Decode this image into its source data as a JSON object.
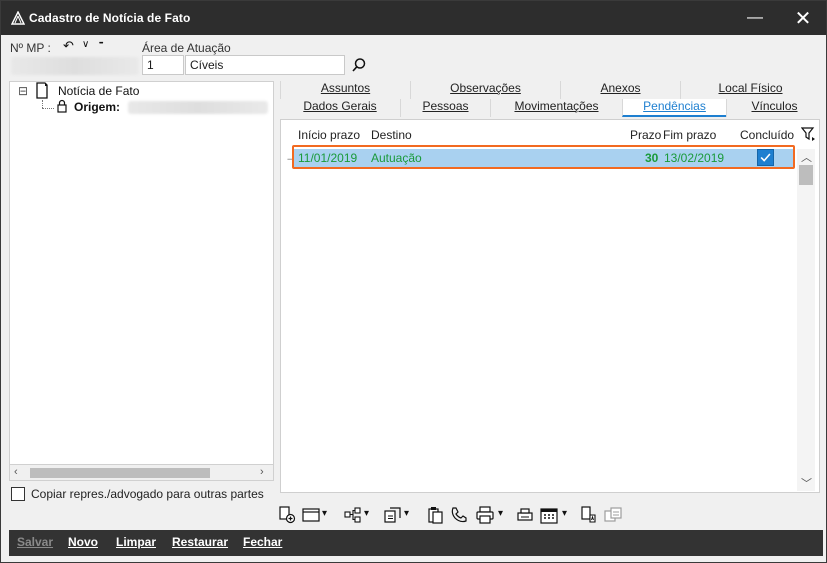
{
  "window": {
    "title": "Cadastro de Notícia de Fato",
    "minimize": "—",
    "close": "✕"
  },
  "header": {
    "nmp_label": "Nº MP :",
    "undo_glyph": "↶",
    "chevron_glyph": "∨",
    "more_glyph": "•••",
    "area_label": "Área de Atuação",
    "area_code": "1",
    "area_name": "Cíveis"
  },
  "tree": {
    "expander": "⊟",
    "root_label": "Notícia de Fato",
    "child_label": "Origem:"
  },
  "tabs_top": [
    {
      "label": "Assuntos"
    },
    {
      "label": "Observações"
    },
    {
      "label": "Anexos"
    },
    {
      "label": "Local Físico"
    }
  ],
  "tabs_bottom": [
    {
      "label": "Dados Gerais"
    },
    {
      "label": "Pessoas"
    },
    {
      "label": "Movimentações"
    },
    {
      "label": "Pendências"
    },
    {
      "label": "Vínculos"
    }
  ],
  "grid": {
    "columns": {
      "inicio": "Início prazo",
      "destino": "Destino",
      "prazo": "Prazo",
      "fim": "Fim prazo",
      "concluido": "Concluído"
    },
    "rows": [
      {
        "indicator": "→",
        "inicio": "11/01/2019",
        "destino": "Autuação",
        "prazo": "30",
        "fim": "13/02/2019",
        "concluido": true
      }
    ],
    "colors": {
      "row_bg": "#a9d1f0",
      "row_text": "#1a9a3a",
      "highlight": "#f26a21"
    }
  },
  "scroll": {
    "left": "‹",
    "right": "›",
    "up": "︿",
    "down": "﹀"
  },
  "copy_option": {
    "label": "Copiar repres./advogado para outras partes",
    "checked": false
  },
  "toolbar": {
    "dropdown_glyph": "▾"
  },
  "bottom_buttons": {
    "salvar": "Salvar",
    "novo": "Novo",
    "limpar": "Limpar",
    "restaurar": "Restaurar",
    "fechar": "Fechar"
  }
}
